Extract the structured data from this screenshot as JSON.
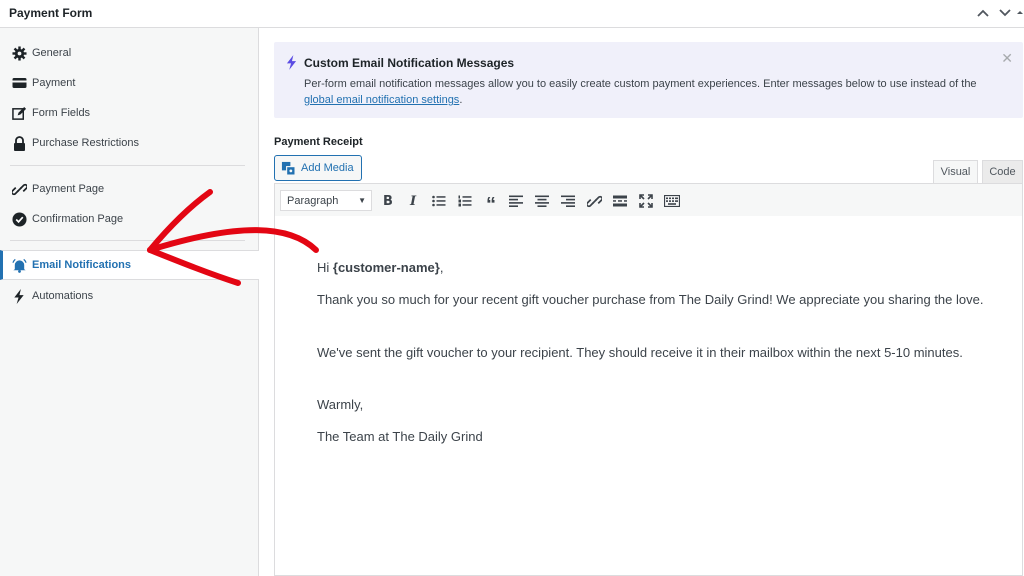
{
  "window": {
    "title": "Payment Form"
  },
  "sidebar": {
    "items": [
      {
        "label": "General",
        "icon": "gear-icon"
      },
      {
        "label": "Payment",
        "icon": "credit-card-icon"
      },
      {
        "label": "Form Fields",
        "icon": "edit-icon"
      },
      {
        "label": "Purchase Restrictions",
        "icon": "lock-icon"
      },
      {
        "label": "Payment Page",
        "icon": "link-icon"
      },
      {
        "label": "Confirmation Page",
        "icon": "check-circle-icon"
      },
      {
        "label": "Email Notifications",
        "icon": "bell-icon"
      },
      {
        "label": "Automations",
        "icon": "bolt-icon"
      }
    ],
    "active": "Email Notifications"
  },
  "notice": {
    "title": "Custom Email Notification Messages",
    "body": "Per-form email notification messages allow you to easily create custom payment experiences. Enter messages below to use instead of the",
    "link": "global email notification settings",
    "link_suffix": "."
  },
  "editor": {
    "label": "Payment Receipt",
    "add_media": "Add Media",
    "tabs": [
      "Visual",
      "Code"
    ],
    "format": "Paragraph",
    "greeting_prefix": "Hi ",
    "greeting_tag": "{customer-name}",
    "greeting_suffix": ",",
    "paragraphs": [
      "Thank you so much for your recent gift voucher purchase from The Daily Grind! We appreciate you sharing the love.",
      "We've sent the gift voucher to your recipient. They should receive it in their mailbox within the next 5-10 minutes.",
      "Warmly,",
      "The Team at The Daily Grind"
    ]
  },
  "colors": {
    "accent": "#2271b1",
    "annotation": "#e30613",
    "notice_bg": "#f0f0fa",
    "bolt": "#5b4ce3"
  }
}
